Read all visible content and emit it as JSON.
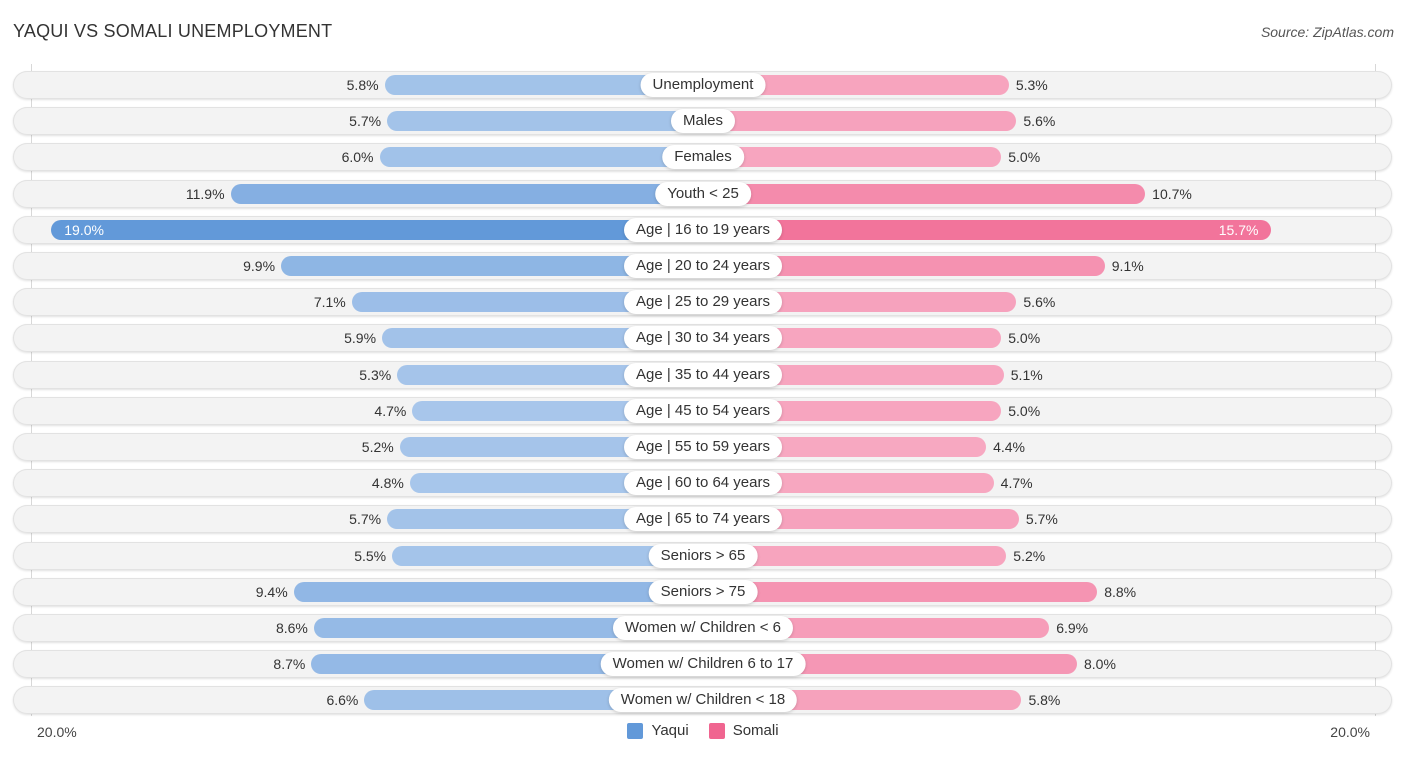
{
  "header": {
    "title": "YAQUI VS SOMALI UNEMPLOYMENT",
    "source": "Source: ZipAtlas.com"
  },
  "colors": {
    "yaqui_light": "#a9c7eb",
    "yaqui_dark": "#6299d9",
    "somali_light": "#f7a8c1",
    "somali_dark": "#f06590"
  },
  "chart_data": {
    "type": "bar",
    "orientation": "horizontal-diverging",
    "title": "YAQUI VS SOMALI UNEMPLOYMENT",
    "categories": [
      "Unemployment",
      "Males",
      "Females",
      "Youth < 25",
      "Age | 16 to 19 years",
      "Age | 20 to 24 years",
      "Age | 25 to 29 years",
      "Age | 30 to 34 years",
      "Age | 35 to 44 years",
      "Age | 45 to 54 years",
      "Age | 55 to 59 years",
      "Age | 60 to 64 years",
      "Age | 65 to 74 years",
      "Seniors > 65",
      "Seniors > 75",
      "Women w/ Children < 6",
      "Women w/ Children 6 to 17",
      "Women w/ Children < 18"
    ],
    "series": [
      {
        "name": "Yaqui",
        "side": "left",
        "values": [
          5.8,
          5.7,
          6.0,
          11.9,
          19.0,
          9.9,
          7.1,
          5.9,
          5.3,
          4.7,
          5.2,
          4.8,
          5.7,
          5.5,
          9.4,
          8.6,
          8.7,
          6.6
        ],
        "labels": [
          "5.8%",
          "5.7%",
          "6.0%",
          "11.9%",
          "19.0%",
          "9.9%",
          "7.1%",
          "5.9%",
          "5.3%",
          "4.7%",
          "5.2%",
          "4.8%",
          "5.7%",
          "5.5%",
          "9.4%",
          "8.6%",
          "8.7%",
          "6.6%"
        ]
      },
      {
        "name": "Somali",
        "side": "right",
        "values": [
          5.3,
          5.6,
          5.0,
          10.7,
          15.7,
          9.1,
          5.6,
          5.0,
          5.1,
          5.0,
          4.4,
          4.7,
          5.7,
          5.2,
          8.8,
          6.9,
          8.0,
          5.8
        ],
        "labels": [
          "5.3%",
          "5.6%",
          "5.0%",
          "10.7%",
          "15.7%",
          "9.1%",
          "5.6%",
          "5.0%",
          "5.1%",
          "5.0%",
          "4.4%",
          "4.7%",
          "5.7%",
          "5.2%",
          "8.8%",
          "6.9%",
          "8.0%",
          "5.8%"
        ]
      }
    ],
    "axis": {
      "left_label": "20.0%",
      "right_label": "20.0%",
      "max": 20.0
    },
    "legend": {
      "position": "bottom-center",
      "items": [
        "Yaqui",
        "Somali"
      ]
    },
    "grid": false
  }
}
